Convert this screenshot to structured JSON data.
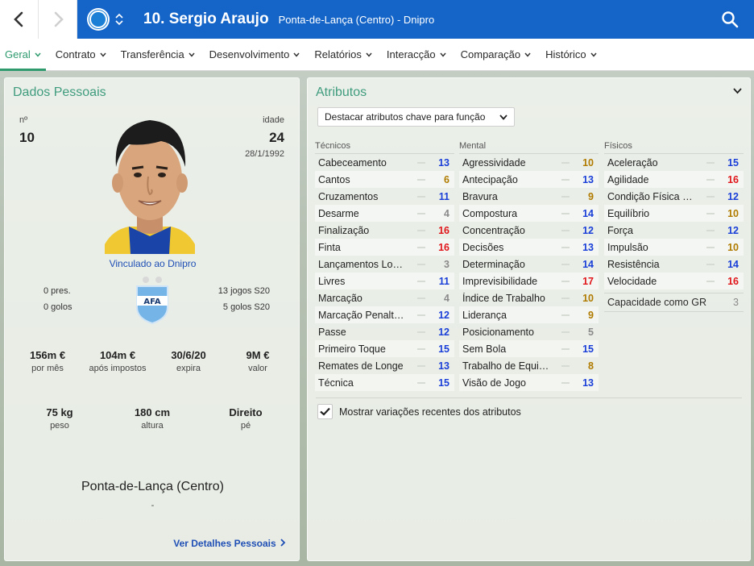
{
  "header": {
    "player_title": "10. Sergio Araujo",
    "subtitle": "Ponta-de-Lança (Centro) - Dnipro",
    "back_icon": "chevron-left-icon",
    "forward_icon": "chevron-right-icon",
    "club_badge_icon": "club-badge-icon",
    "search_icon": "search-icon",
    "brand_color": "#1565c8"
  },
  "tabs": [
    {
      "label": "Geral",
      "active": true
    },
    {
      "label": "Contrato"
    },
    {
      "label": "Transferência"
    },
    {
      "label": "Desenvolvimento"
    },
    {
      "label": "Relatórios"
    },
    {
      "label": "Interacção"
    },
    {
      "label": "Comparação"
    },
    {
      "label": "Histórico"
    }
  ],
  "personal": {
    "title": "Dados Pessoais",
    "number_label": "nº",
    "number": "10",
    "age_label": "idade",
    "age": "24",
    "birthdate": "28/1/1992",
    "linked": "Vinculado ao Dnipro",
    "apps": "0 pres.",
    "goals": "0 golos",
    "u20_games": "13 jogos S20",
    "u20_goals": "5 golos S20",
    "wage": {
      "value": "156m €",
      "label": "por mês"
    },
    "after_tax": {
      "value": "104m €",
      "label": "após impostos"
    },
    "expires": {
      "value": "30/6/20",
      "label": "expira"
    },
    "market_value": {
      "value": "9M €",
      "label": "valor"
    },
    "weight": {
      "value": "75 kg",
      "label": "peso"
    },
    "height": {
      "value": "180 cm",
      "label": "altura"
    },
    "foot": {
      "value": "Direito",
      "label": "pé"
    },
    "position": "Ponta-de-Lança (Centro)",
    "position_sub": "-",
    "details_link": "Ver Detalhes Pessoais"
  },
  "attributes": {
    "title": "Atributos",
    "highlight_dropdown": "Destacar atributos chave para função",
    "technical": {
      "label": "Técnicos",
      "items": [
        {
          "name": "Cabeceamento",
          "value": 13
        },
        {
          "name": "Cantos",
          "value": 6
        },
        {
          "name": "Cruzamentos",
          "value": 11
        },
        {
          "name": "Desarme",
          "value": 4
        },
        {
          "name": "Finalização",
          "value": 16
        },
        {
          "name": "Finta",
          "value": 16
        },
        {
          "name": "Lançamentos Lon...",
          "value": 3
        },
        {
          "name": "Livres",
          "value": 11
        },
        {
          "name": "Marcação",
          "value": 4
        },
        {
          "name": "Marcação Penalties",
          "value": 12
        },
        {
          "name": "Passe",
          "value": 12
        },
        {
          "name": "Primeiro Toque",
          "value": 15
        },
        {
          "name": "Remates de Longe",
          "value": 13
        },
        {
          "name": "Técnica",
          "value": 15
        }
      ]
    },
    "mental": {
      "label": "Mental",
      "items": [
        {
          "name": "Agressividade",
          "value": 10
        },
        {
          "name": "Antecipação",
          "value": 13
        },
        {
          "name": "Bravura",
          "value": 9
        },
        {
          "name": "Compostura",
          "value": 14
        },
        {
          "name": "Concentração",
          "value": 12
        },
        {
          "name": "Decisões",
          "value": 13
        },
        {
          "name": "Determinação",
          "value": 14
        },
        {
          "name": "Imprevisibilidade",
          "value": 17
        },
        {
          "name": "Índice de Trabalho",
          "value": 10
        },
        {
          "name": "Liderança",
          "value": 9
        },
        {
          "name": "Posicionamento",
          "value": 5
        },
        {
          "name": "Sem Bola",
          "value": 15
        },
        {
          "name": "Trabalho de Equipa",
          "value": 8
        },
        {
          "name": "Visão de Jogo",
          "value": 13
        }
      ]
    },
    "physical": {
      "label": "Físicos",
      "items": [
        {
          "name": "Aceleração",
          "value": 15
        },
        {
          "name": "Agilidade",
          "value": 16
        },
        {
          "name": "Condição Física N...",
          "value": 12
        },
        {
          "name": "Equilíbrio",
          "value": 10
        },
        {
          "name": "Força",
          "value": 12
        },
        {
          "name": "Impulsão",
          "value": 10
        },
        {
          "name": "Resistência",
          "value": 14
        },
        {
          "name": "Velocidade",
          "value": 16
        }
      ]
    },
    "gk_capability": {
      "name": "Capacidade como GR",
      "value": 3
    },
    "show_changes": "Mostrar variações recentes dos atributos",
    "show_changes_checked": true
  }
}
